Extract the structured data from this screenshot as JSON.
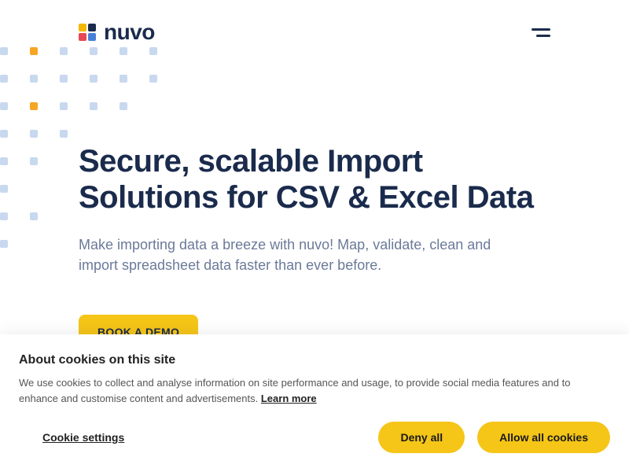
{
  "header": {
    "brand": "nuvo"
  },
  "hero": {
    "title": "Secure, scalable Import Solutions for CSV & Excel Data",
    "subtitle": "Make importing data a breeze with nuvo! Map, validate, clean and import spreadsheet data faster than ever before.",
    "cta_label": "BOOK A DEMO"
  },
  "cookie_banner": {
    "title": "About cookies on this site",
    "text": "We use cookies to collect and analyse information on site performance and usage, to provide social media features and to enhance and customise content and advertisements. ",
    "learn_more": "Learn more",
    "settings_label": "Cookie settings",
    "deny_label": "Deny all",
    "allow_label": "Allow all cookies"
  }
}
